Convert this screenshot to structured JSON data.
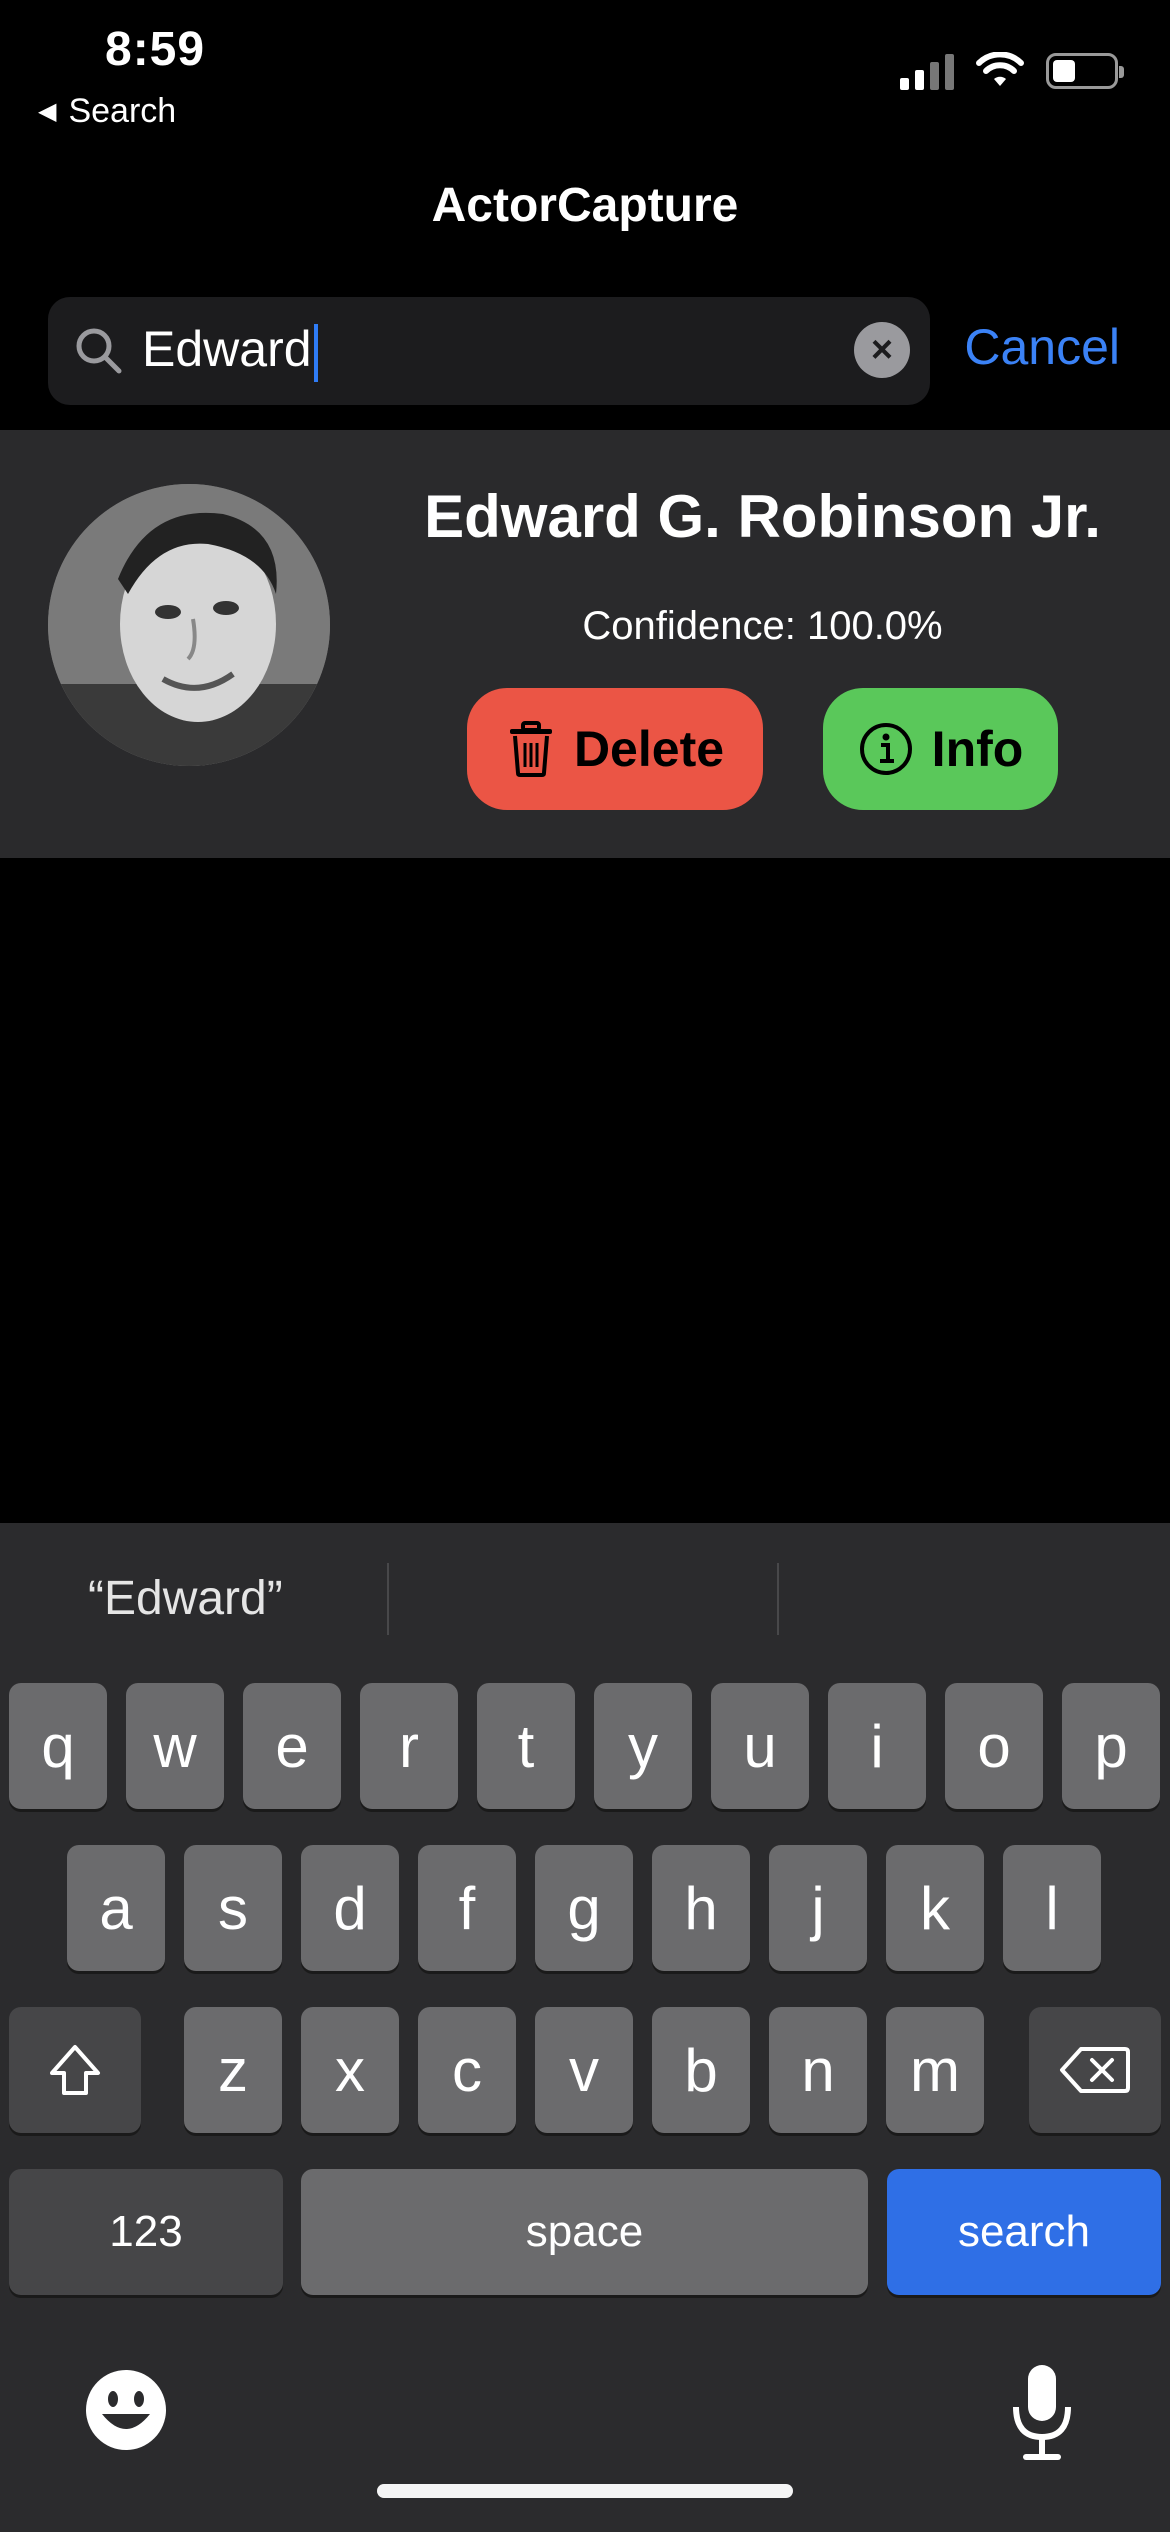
{
  "status_bar": {
    "time": "8:59",
    "back_label": "Search"
  },
  "app": {
    "title": "ActorCapture"
  },
  "search": {
    "value": "Edward",
    "cancel_label": "Cancel",
    "clear_symbol": "×"
  },
  "result": {
    "name": "Edward G. Robinson Jr.",
    "confidence": "Confidence: 100.0%",
    "delete_label": "Delete",
    "info_label": "Info"
  },
  "keyboard": {
    "suggestion": "“Edward”",
    "row1": [
      "q",
      "w",
      "e",
      "r",
      "t",
      "y",
      "u",
      "i",
      "o",
      "p"
    ],
    "row2": [
      "a",
      "s",
      "d",
      "f",
      "g",
      "h",
      "j",
      "k",
      "l"
    ],
    "row3": [
      "z",
      "x",
      "c",
      "v",
      "b",
      "n",
      "m"
    ],
    "numbers_label": "123",
    "space_label": "space",
    "search_label": "search"
  },
  "colors": {
    "accent": "#3b82f6",
    "delete": "#eb5545",
    "info": "#5ac85a",
    "search_key": "#2f6fe6"
  }
}
